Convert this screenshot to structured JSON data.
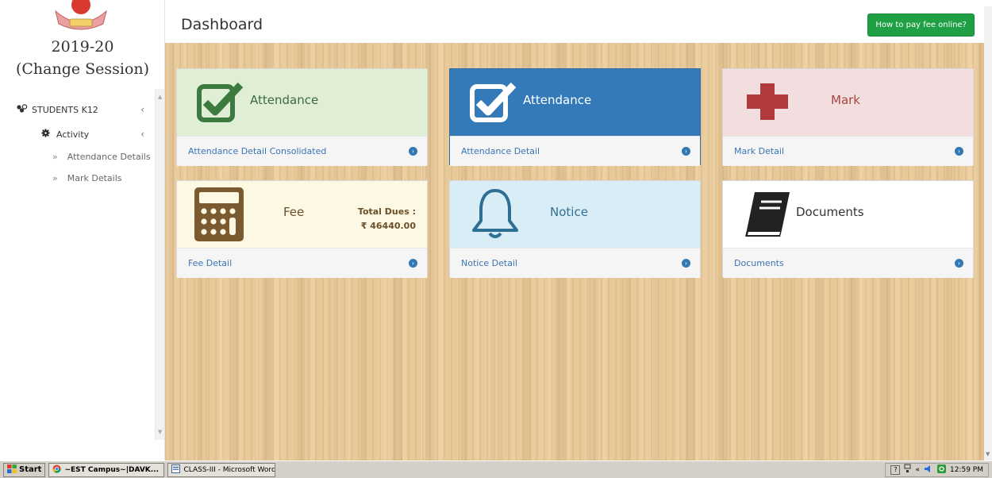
{
  "sidebar": {
    "session_year": "2019-20",
    "change_session": "(Change Session)",
    "menu": {
      "students": "STUDENTS K12",
      "activity": "Activity",
      "sub_items": [
        "Attendance Details",
        "Mark Details"
      ],
      "arrow": "»",
      "chevron": "‹"
    }
  },
  "header": {
    "title": "Dashboard",
    "pay_button": "How to pay fee online?"
  },
  "tiles": [
    {
      "title": "Attendance",
      "link": "Attendance Detail Consolidated",
      "icon": "check-square-icon",
      "color": "#dfeed4",
      "icon_color": "#3d7a3f"
    },
    {
      "title": "Attendance",
      "link": "Attendance Detail",
      "icon": "check-square-icon",
      "color": "#347ab8",
      "icon_color": "#ffffff"
    },
    {
      "title": "Mark",
      "link": "Mark Detail",
      "icon": "plus-icon",
      "color": "#f2dede",
      "icon_color": "#b33a3a"
    },
    {
      "title": "Fee",
      "link": "Fee Detail",
      "icon": "calculator-icon",
      "color": "#fcf8e3",
      "icon_color": "#7a5a2e",
      "dues_label": "Total Dues :",
      "dues_value": "₹ 46440.00"
    },
    {
      "title": "Notice",
      "link": "Notice Detail",
      "icon": "bell-icon",
      "color": "#d9edf7",
      "icon_color": "#2f6f93"
    },
    {
      "title": "Documents",
      "link": "Documents",
      "icon": "book-icon",
      "color": "#ffffff",
      "icon_color": "#222222"
    }
  ],
  "taskbar": {
    "start": "Start",
    "tasks": [
      "~EST Campus~|DAVK...",
      "CLASS-III - Microsoft Word"
    ],
    "clock": "12:59 PM",
    "tray_text": "«"
  },
  "colors": {
    "accent_green": "#1fa045",
    "link_blue": "#3a75b5",
    "wood": "#e8c999"
  }
}
